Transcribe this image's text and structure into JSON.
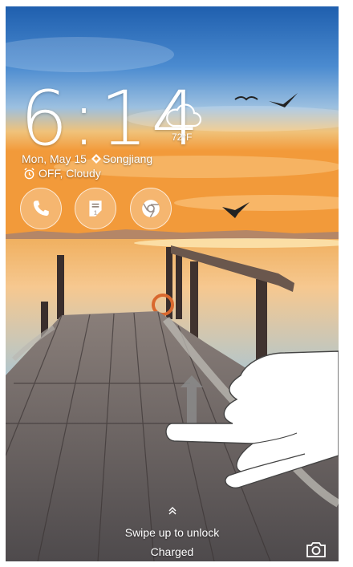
{
  "clock": {
    "time": "6:14"
  },
  "weather": {
    "icon": "cloud-icon",
    "temperature": "72°F"
  },
  "date_line": {
    "date": "Mon, May 15",
    "location": "Songjiang"
  },
  "alarm_line": {
    "text": "OFF, Cloudy"
  },
  "shortcuts": [
    {
      "icon": "phone-icon"
    },
    {
      "icon": "memo-icon",
      "badge": "1"
    },
    {
      "icon": "chrome-icon"
    }
  ],
  "bottom": {
    "swipe_text": "Swipe up to unlock",
    "status_text": "Charged",
    "camera_icon": "camera-icon"
  },
  "colors": {
    "text": "#ffffff",
    "sky_top": "#2f6fb5",
    "sunset": "#f2a03a"
  }
}
